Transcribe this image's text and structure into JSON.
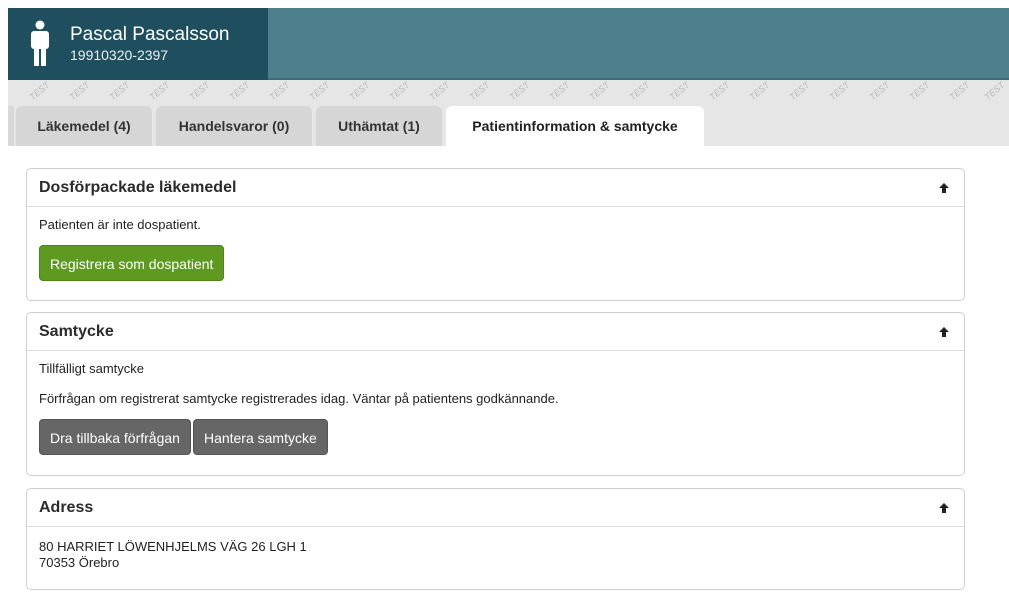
{
  "header": {
    "patient_name": "Pascal Pascalsson",
    "patient_id": "19910320-2397",
    "icon": "person-icon",
    "accent_color": "#1f4f5e",
    "bar_color": "#4e7f8c"
  },
  "watermark": {
    "text": "TEST"
  },
  "tabs": [
    {
      "label": "Läkemedel  (4)"
    },
    {
      "label": "Handelsvaror (0)"
    },
    {
      "label": "Uthämtat  (1)"
    },
    {
      "label": "Patientinformation & samtycke"
    }
  ],
  "sections": {
    "dos": {
      "title": "Dosförpackade läkemedel",
      "text": "Patienten är inte dospatient.",
      "button": "Registrera som dospatient",
      "button_color": "#5e9a20"
    },
    "samtycke": {
      "title": "Samtycke",
      "line1": "Tillfälligt samtycke",
      "line2": "Förfrågan om registrerat samtycke registrerades idag. Väntar på patientens godkännande.",
      "button_withdraw": "Dra tillbaka förfrågan",
      "button_manage": "Hantera samtycke"
    },
    "adress": {
      "title": "Adress",
      "line1": "80 HARRIET LÖWENHJELMS VÄG 26 LGH 1",
      "line2": "70353 Örebro"
    }
  }
}
